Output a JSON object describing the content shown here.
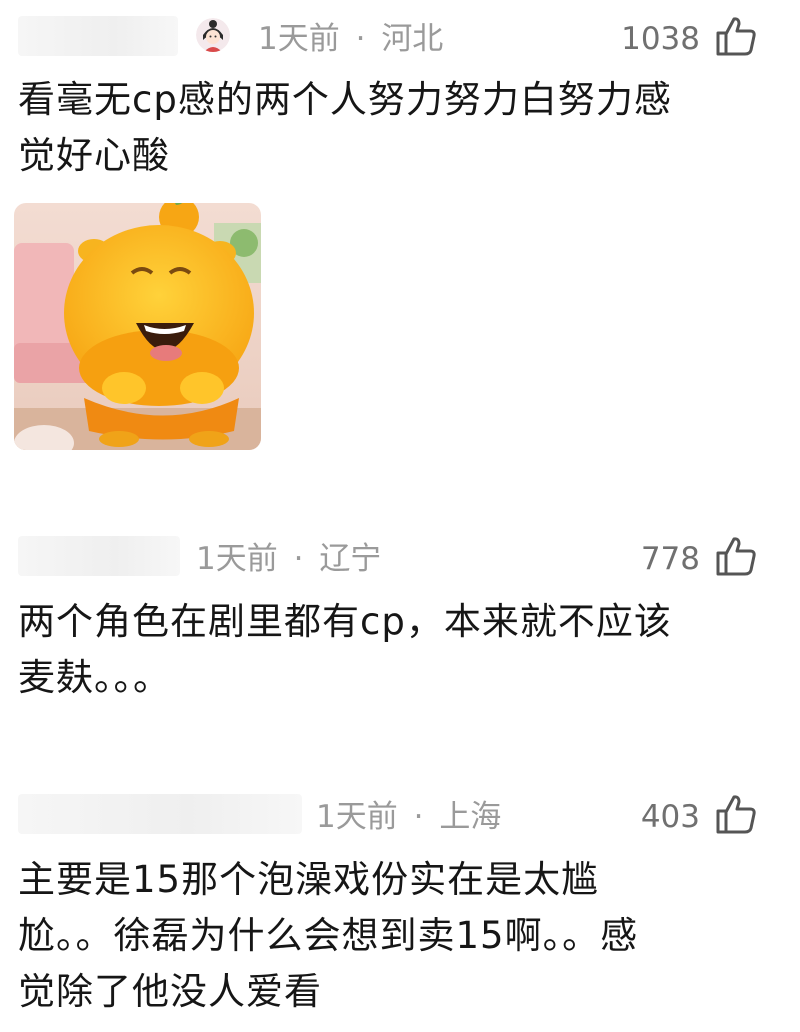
{
  "comments": [
    {
      "time": "1天前",
      "sep": "·",
      "location": "河北",
      "likes": "1038",
      "text_line1": "看毫无cp感的两个人努力努力白努力感",
      "text_line2": "觉好心酸",
      "has_avatar": true,
      "has_sticker": true
    },
    {
      "time": "1天前",
      "sep": "·",
      "location": "辽宁",
      "likes": "778",
      "text_line1": "两个角色在剧里都有cp，本来就不应该",
      "text_line2": "麦麸。。。"
    },
    {
      "time": "1天前",
      "sep": "·",
      "location": "上海",
      "likes": "403",
      "text_line1": "主要是15那个泡澡戏份实在是太尴",
      "text_line2": "尬。。徐磊为什么会想到卖15啊。。感",
      "text_line3": "觉除了他没人爱看"
    }
  ],
  "icons": {
    "like": "thumbs-up-icon",
    "sticker": "laughing-orange-creature-sticker",
    "avatar": "girl-avatar-icon"
  },
  "colors": {
    "meta": "#9a9a9a",
    "likes": "#707070",
    "text": "#161616"
  }
}
